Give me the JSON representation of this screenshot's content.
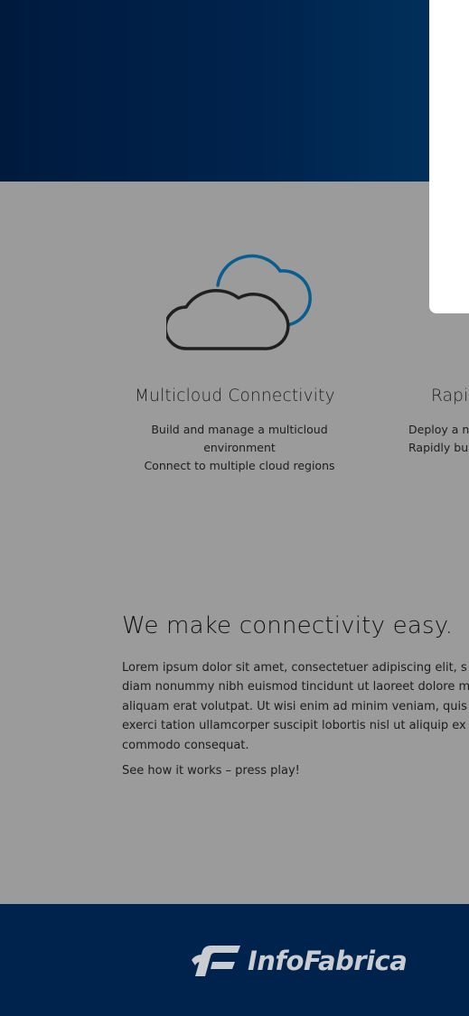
{
  "hero": {},
  "features": [
    {
      "title": "Multicloud Connectivity",
      "desc_line1": "Build and manage a multicloud environment",
      "desc_line2": "Connect to multiple cloud regions",
      "icon": "cloud-icon"
    },
    {
      "title": "Rapi",
      "desc_line1": "Deploy a n",
      "desc_line2": "Rapidly bu"
    }
  ],
  "about": {
    "heading": "We make connectivity easy.",
    "body_lines": [
      "Lorem ipsum dolor sit amet, consectetuer adipiscing elit, s",
      "diam nonummy nibh euismod tincidunt ut laoreet dolore m",
      "aliquam erat volutpat. Ut wisi enim ad minim veniam, quis",
      "exerci tation ullamcorper suscipit lobortis nisl ut aliquip ex",
      "commodo consequat."
    ],
    "cta": "See how it works – press play!"
  },
  "footer": {
    "logo_text": "InfoFabrica",
    "logo_icon": "infofabrica-logo-icon"
  },
  "colors": {
    "navy": "#00234d",
    "gray_bg": "#9b9b9b",
    "cloud_accent": "#0a5d8f",
    "cloud_stroke": "#1f1f1f"
  }
}
